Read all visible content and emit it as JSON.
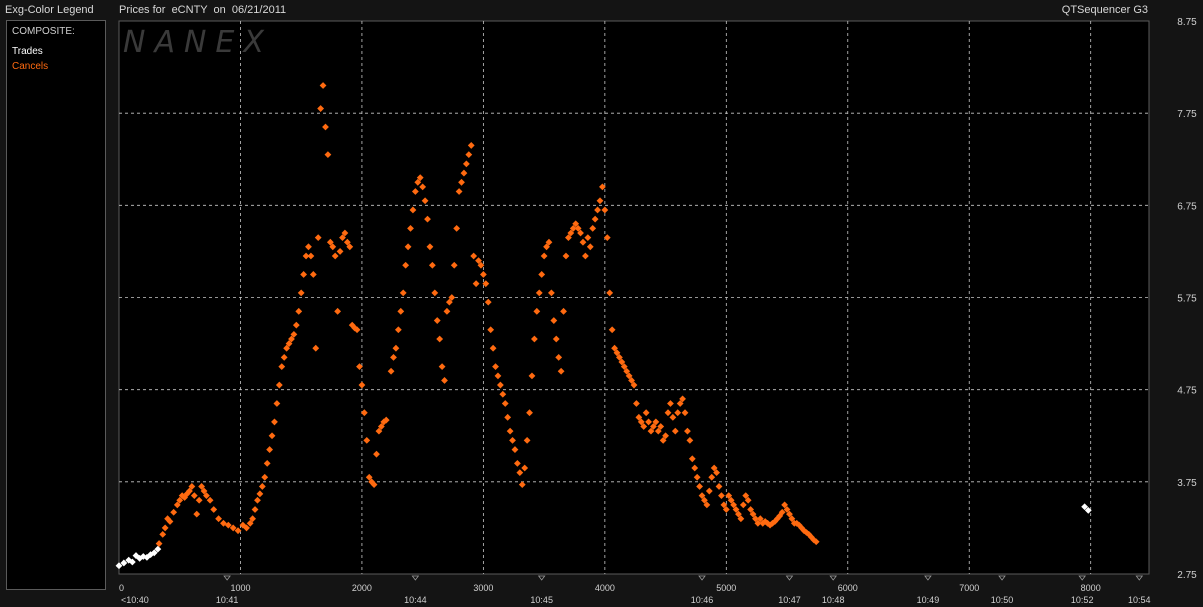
{
  "header": {
    "legend_title": "Exg-Color Legend",
    "chart_title": "Prices for  eCNTY  on  06/21/2011",
    "app_name": "QTSequencer G3"
  },
  "legend": {
    "heading": "COMPOSITE:",
    "items": [
      {
        "label": "Trades",
        "color": "#ffffff"
      },
      {
        "label": "Cancels",
        "color": "#ff6a10"
      }
    ]
  },
  "watermark": "NANEX",
  "colors": {
    "trades": "#ffffff",
    "cancels": "#ff6a10",
    "grid": "#c8c8c8",
    "background": "#000000"
  },
  "chart_data": {
    "type": "scatter",
    "title": "Prices for  eCNTY  on  06/21/2011",
    "xlabel": "",
    "ylabel": "",
    "xlim": [
      0,
      8480
    ],
    "ylim": [
      2.75,
      8.75
    ],
    "grid": true,
    "y_ticks": [
      "2.75",
      "3.75",
      "4.75",
      "5.75",
      "6.75",
      "7.75",
      "8.75"
    ],
    "x_ticks": [
      {
        "value": 0,
        "label": "0"
      },
      {
        "value": 1000,
        "label": "1000"
      },
      {
        "value": 2000,
        "label": "2000"
      },
      {
        "value": 3000,
        "label": "3000"
      },
      {
        "value": 4000,
        "label": "4000"
      },
      {
        "value": 5000,
        "label": "5000"
      },
      {
        "value": 6000,
        "label": "6000"
      },
      {
        "value": 7000,
        "label": "7000"
      },
      {
        "value": 8000,
        "label": "8000"
      }
    ],
    "time_ticks": [
      {
        "value": 0,
        "label": "<10:40"
      },
      {
        "value": 890,
        "label": "10:41"
      },
      {
        "value": 2440,
        "label": "10:44"
      },
      {
        "value": 3480,
        "label": "10:45"
      },
      {
        "value": 4800,
        "label": "10:46"
      },
      {
        "value": 5520,
        "label": "10:47"
      },
      {
        "value": 5880,
        "label": "10:48"
      },
      {
        "value": 6660,
        "label": "10:49"
      },
      {
        "value": 7270,
        "label": "10:50"
      },
      {
        "value": 7930,
        "label": "10:52"
      },
      {
        "value": 8400,
        "label": "10:54"
      }
    ],
    "series": [
      {
        "name": "Trades",
        "color": "#ffffff",
        "points": [
          [
            0,
            2.84
          ],
          [
            40,
            2.87
          ],
          [
            80,
            2.9
          ],
          [
            110,
            2.88
          ],
          [
            140,
            2.95
          ],
          [
            170,
            2.92
          ],
          [
            200,
            2.94
          ],
          [
            230,
            2.93
          ],
          [
            260,
            2.96
          ],
          [
            290,
            2.98
          ],
          [
            320,
            3.02
          ],
          [
            7950,
            3.48
          ],
          [
            7980,
            3.44
          ]
        ]
      },
      {
        "name": "Cancels",
        "color": "#ff6a10",
        "points": [
          [
            330,
            3.08
          ],
          [
            360,
            3.18
          ],
          [
            380,
            3.25
          ],
          [
            400,
            3.35
          ],
          [
            420,
            3.32
          ],
          [
            450,
            3.42
          ],
          [
            480,
            3.5
          ],
          [
            500,
            3.55
          ],
          [
            520,
            3.6
          ],
          [
            540,
            3.58
          ],
          [
            560,
            3.62
          ],
          [
            580,
            3.65
          ],
          [
            600,
            3.7
          ],
          [
            620,
            3.6
          ],
          [
            640,
            3.4
          ],
          [
            660,
            3.55
          ],
          [
            680,
            3.7
          ],
          [
            700,
            3.65
          ],
          [
            720,
            3.6
          ],
          [
            750,
            3.55
          ],
          [
            780,
            3.45
          ],
          [
            820,
            3.35
          ],
          [
            860,
            3.3
          ],
          [
            900,
            3.28
          ],
          [
            940,
            3.25
          ],
          [
            980,
            3.22
          ],
          [
            1020,
            3.28
          ],
          [
            1050,
            3.25
          ],
          [
            1080,
            3.3
          ],
          [
            1100,
            3.35
          ],
          [
            1120,
            3.45
          ],
          [
            1140,
            3.55
          ],
          [
            1160,
            3.62
          ],
          [
            1180,
            3.7
          ],
          [
            1200,
            3.8
          ],
          [
            1220,
            3.95
          ],
          [
            1240,
            4.1
          ],
          [
            1260,
            4.25
          ],
          [
            1280,
            4.4
          ],
          [
            1300,
            4.6
          ],
          [
            1320,
            4.8
          ],
          [
            1340,
            5.0
          ],
          [
            1360,
            5.1
          ],
          [
            1380,
            5.2
          ],
          [
            1400,
            5.25
          ],
          [
            1420,
            5.3
          ],
          [
            1440,
            5.35
          ],
          [
            1460,
            5.45
          ],
          [
            1480,
            5.6
          ],
          [
            1500,
            5.8
          ],
          [
            1520,
            6.0
          ],
          [
            1540,
            6.2
          ],
          [
            1560,
            6.3
          ],
          [
            1580,
            6.2
          ],
          [
            1600,
            6.0
          ],
          [
            1620,
            5.2
          ],
          [
            1640,
            6.4
          ],
          [
            1660,
            7.8
          ],
          [
            1680,
            8.05
          ],
          [
            1700,
            7.6
          ],
          [
            1720,
            7.3
          ],
          [
            1740,
            6.35
          ],
          [
            1760,
            6.3
          ],
          [
            1780,
            6.2
          ],
          [
            1800,
            5.6
          ],
          [
            1820,
            6.25
          ],
          [
            1840,
            6.4
          ],
          [
            1860,
            6.45
          ],
          [
            1880,
            6.35
          ],
          [
            1900,
            6.3
          ],
          [
            1920,
            5.45
          ],
          [
            1940,
            5.42
          ],
          [
            1960,
            5.4
          ],
          [
            1980,
            5.0
          ],
          [
            2000,
            4.8
          ],
          [
            2020,
            4.5
          ],
          [
            2040,
            4.2
          ],
          [
            2060,
            3.8
          ],
          [
            2080,
            3.75
          ],
          [
            2100,
            3.72
          ],
          [
            2120,
            4.05
          ],
          [
            2140,
            4.3
          ],
          [
            2160,
            4.35
          ],
          [
            2180,
            4.4
          ],
          [
            2200,
            4.42
          ],
          [
            2240,
            4.95
          ],
          [
            2260,
            5.1
          ],
          [
            2280,
            5.2
          ],
          [
            2300,
            5.4
          ],
          [
            2320,
            5.6
          ],
          [
            2340,
            5.8
          ],
          [
            2360,
            6.1
          ],
          [
            2380,
            6.3
          ],
          [
            2400,
            6.5
          ],
          [
            2420,
            6.7
          ],
          [
            2440,
            6.9
          ],
          [
            2460,
            7.0
          ],
          [
            2480,
            7.05
          ],
          [
            2500,
            6.95
          ],
          [
            2520,
            6.8
          ],
          [
            2540,
            6.6
          ],
          [
            2560,
            6.3
          ],
          [
            2580,
            6.1
          ],
          [
            2600,
            5.8
          ],
          [
            2620,
            5.5
          ],
          [
            2640,
            5.3
          ],
          [
            2660,
            5.0
          ],
          [
            2680,
            4.85
          ],
          [
            2700,
            5.6
          ],
          [
            2720,
            5.7
          ],
          [
            2740,
            5.75
          ],
          [
            2760,
            6.1
          ],
          [
            2780,
            6.5
          ],
          [
            2800,
            6.9
          ],
          [
            2820,
            7.0
          ],
          [
            2840,
            7.1
          ],
          [
            2860,
            7.2
          ],
          [
            2880,
            7.3
          ],
          [
            2900,
            7.4
          ],
          [
            2920,
            6.2
          ],
          [
            2940,
            5.9
          ],
          [
            2960,
            6.15
          ],
          [
            2980,
            6.1
          ],
          [
            3000,
            6.0
          ],
          [
            3020,
            5.9
          ],
          [
            3040,
            5.7
          ],
          [
            3060,
            5.4
          ],
          [
            3080,
            5.2
          ],
          [
            3100,
            5.0
          ],
          [
            3120,
            4.9
          ],
          [
            3140,
            4.8
          ],
          [
            3160,
            4.7
          ],
          [
            3180,
            4.6
          ],
          [
            3200,
            4.45
          ],
          [
            3220,
            4.3
          ],
          [
            3240,
            4.2
          ],
          [
            3260,
            4.1
          ],
          [
            3280,
            3.95
          ],
          [
            3300,
            3.85
          ],
          [
            3320,
            3.72
          ],
          [
            3340,
            3.9
          ],
          [
            3360,
            4.2
          ],
          [
            3380,
            4.5
          ],
          [
            3400,
            4.9
          ],
          [
            3420,
            5.3
          ],
          [
            3440,
            5.6
          ],
          [
            3460,
            5.8
          ],
          [
            3480,
            6.0
          ],
          [
            3500,
            6.2
          ],
          [
            3520,
            6.3
          ],
          [
            3540,
            6.35
          ],
          [
            3560,
            5.8
          ],
          [
            3580,
            5.5
          ],
          [
            3600,
            5.3
          ],
          [
            3620,
            5.1
          ],
          [
            3640,
            4.95
          ],
          [
            3660,
            5.6
          ],
          [
            3680,
            6.2
          ],
          [
            3700,
            6.4
          ],
          [
            3720,
            6.45
          ],
          [
            3740,
            6.5
          ],
          [
            3760,
            6.55
          ],
          [
            3780,
            6.5
          ],
          [
            3800,
            6.45
          ],
          [
            3820,
            6.35
          ],
          [
            3840,
            6.2
          ],
          [
            3860,
            6.4
          ],
          [
            3880,
            6.3
          ],
          [
            3900,
            6.5
          ],
          [
            3920,
            6.6
          ],
          [
            3940,
            6.7
          ],
          [
            3960,
            6.8
          ],
          [
            3980,
            6.95
          ],
          [
            4000,
            6.7
          ],
          [
            4020,
            6.4
          ],
          [
            4040,
            5.8
          ],
          [
            4060,
            5.4
          ],
          [
            4080,
            5.2
          ],
          [
            4100,
            5.15
          ],
          [
            4120,
            5.1
          ],
          [
            4140,
            5.05
          ],
          [
            4160,
            5.0
          ],
          [
            4180,
            4.95
          ],
          [
            4200,
            4.9
          ],
          [
            4220,
            4.85
          ],
          [
            4240,
            4.8
          ],
          [
            4260,
            4.6
          ],
          [
            4280,
            4.45
          ],
          [
            4300,
            4.4
          ],
          [
            4320,
            4.35
          ],
          [
            4340,
            4.5
          ],
          [
            4360,
            4.4
          ],
          [
            4380,
            4.3
          ],
          [
            4400,
            4.35
          ],
          [
            4420,
            4.4
          ],
          [
            4440,
            4.3
          ],
          [
            4460,
            4.35
          ],
          [
            4480,
            4.2
          ],
          [
            4500,
            4.25
          ],
          [
            4520,
            4.5
          ],
          [
            4540,
            4.6
          ],
          [
            4560,
            4.45
          ],
          [
            4580,
            4.3
          ],
          [
            4600,
            4.5
          ],
          [
            4620,
            4.6
          ],
          [
            4640,
            4.65
          ],
          [
            4660,
            4.5
          ],
          [
            4680,
            4.3
          ],
          [
            4700,
            4.2
          ],
          [
            4720,
            4.0
          ],
          [
            4740,
            3.9
          ],
          [
            4760,
            3.8
          ],
          [
            4780,
            3.7
          ],
          [
            4800,
            3.6
          ],
          [
            4820,
            3.55
          ],
          [
            4840,
            3.5
          ],
          [
            4860,
            3.65
          ],
          [
            4880,
            3.8
          ],
          [
            4900,
            3.9
          ],
          [
            4920,
            3.85
          ],
          [
            4940,
            3.7
          ],
          [
            4960,
            3.6
          ],
          [
            4980,
            3.5
          ],
          [
            5000,
            3.45
          ],
          [
            5020,
            3.6
          ],
          [
            5040,
            3.55
          ],
          [
            5060,
            3.5
          ],
          [
            5080,
            3.45
          ],
          [
            5100,
            3.4
          ],
          [
            5120,
            3.35
          ],
          [
            5140,
            3.5
          ],
          [
            5160,
            3.6
          ],
          [
            5180,
            3.55
          ],
          [
            5200,
            3.45
          ],
          [
            5220,
            3.4
          ],
          [
            5240,
            3.35
          ],
          [
            5260,
            3.3
          ],
          [
            5280,
            3.35
          ],
          [
            5300,
            3.3
          ],
          [
            5320,
            3.32
          ],
          [
            5340,
            3.3
          ],
          [
            5360,
            3.28
          ],
          [
            5380,
            3.3
          ],
          [
            5400,
            3.32
          ],
          [
            5420,
            3.35
          ],
          [
            5440,
            3.38
          ],
          [
            5460,
            3.42
          ],
          [
            5480,
            3.5
          ],
          [
            5500,
            3.45
          ],
          [
            5520,
            3.4
          ],
          [
            5540,
            3.35
          ],
          [
            5560,
            3.3
          ],
          [
            5580,
            3.3
          ],
          [
            5600,
            3.28
          ],
          [
            5620,
            3.25
          ],
          [
            5640,
            3.22
          ],
          [
            5660,
            3.2
          ],
          [
            5680,
            3.18
          ],
          [
            5700,
            3.15
          ],
          [
            5720,
            3.12
          ],
          [
            5740,
            3.1
          ]
        ]
      }
    ]
  }
}
